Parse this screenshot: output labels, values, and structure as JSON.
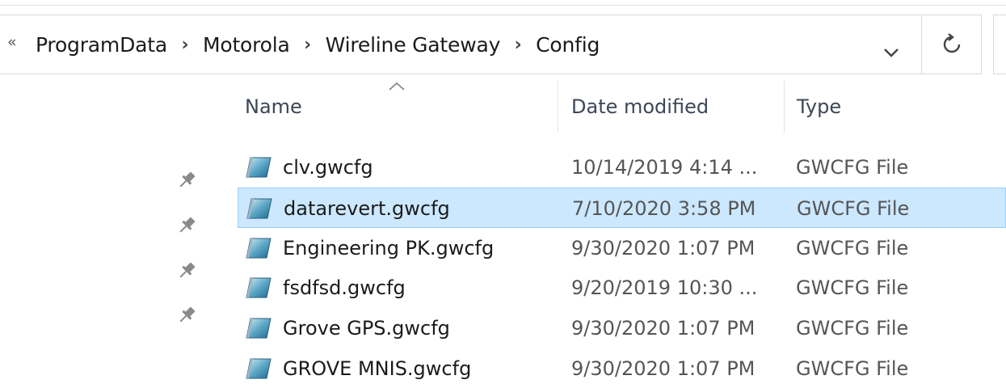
{
  "address_bar": {
    "overflow_glyph": "«",
    "separator": "›",
    "crumbs": [
      "ProgramData",
      "Motorola",
      "Wireline Gateway",
      "Config"
    ]
  },
  "columns": {
    "name": "Name",
    "date": "Date modified",
    "type": "Type",
    "sorted_by": "name",
    "sort_direction": "ascending"
  },
  "files": [
    {
      "name": "clv.gwcfg",
      "date": "10/14/2019 4:14 ...",
      "type": "GWCFG File",
      "selected": false
    },
    {
      "name": "datarevert.gwcfg",
      "date": "7/10/2020 3:58 PM",
      "type": "GWCFG File",
      "selected": true
    },
    {
      "name": "Engineering PK.gwcfg",
      "date": "9/30/2020 1:07 PM",
      "type": "GWCFG File",
      "selected": false
    },
    {
      "name": "fsdfsd.gwcfg",
      "date": "9/20/2019 10:30 ...",
      "type": "GWCFG File",
      "selected": false
    },
    {
      "name": "Grove GPS.gwcfg",
      "date": "9/30/2020 1:07 PM",
      "type": "GWCFG File",
      "selected": false
    },
    {
      "name": "GROVE MNIS.gwcfg",
      "date": "9/30/2020 1:07 PM",
      "type": "GWCFG File",
      "selected": false
    }
  ],
  "icons": {
    "overflow": "chevrons-left-icon",
    "separator": "chevron-right-icon",
    "dropdown": "chevron-down-icon",
    "refresh": "refresh-icon",
    "sort": "sort-ascending-caret-icon",
    "pin": "pin-icon",
    "file": "gwcfg-file-icon"
  },
  "colors": {
    "selection_fill": "#cce8ff",
    "selection_border": "#99d1ff",
    "header_text": "#3c4757"
  }
}
